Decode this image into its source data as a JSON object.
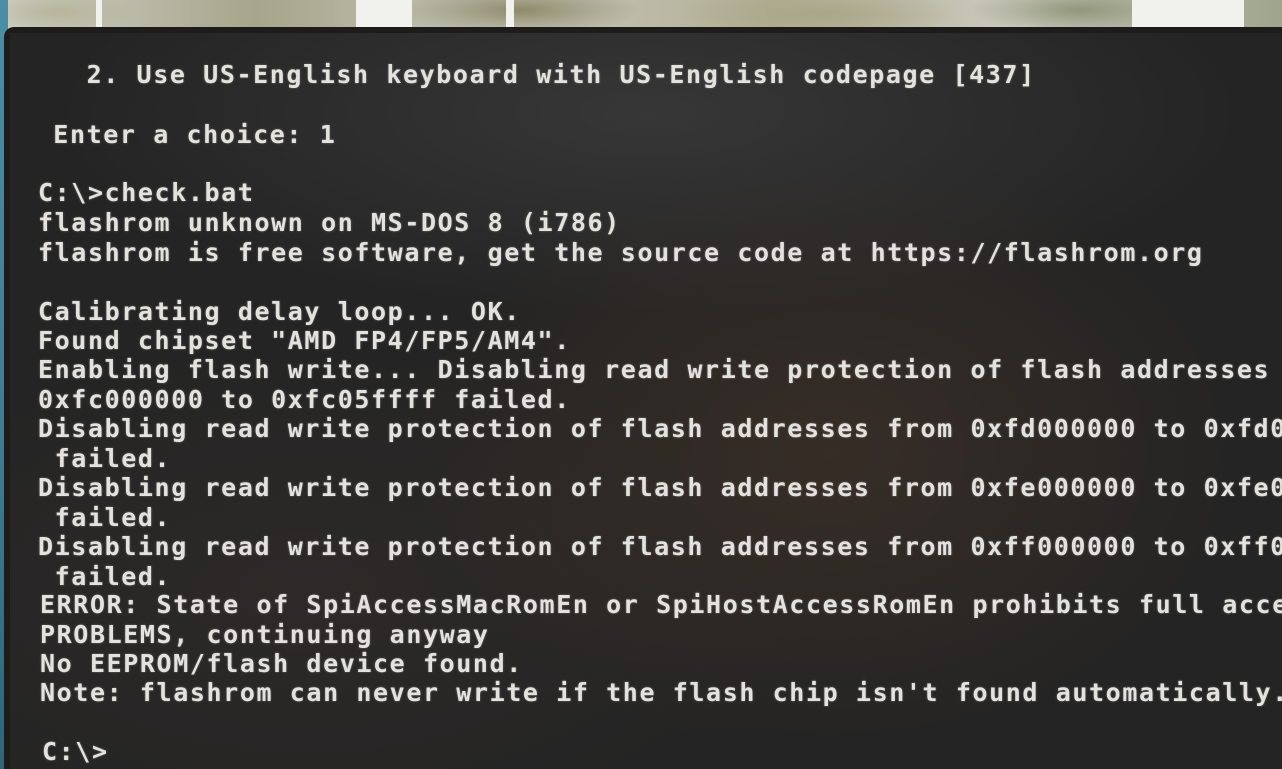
{
  "scene": {
    "description": "Photo of a monitor showing an MS-DOS console running flashrom check.bat"
  },
  "console": {
    "lines": [
      "    2. Use US-English keyboard with US-English codepage [437]",
      "  Enter a choice: 1",
      "C:\\>check.bat",
      "flashrom unknown on MS-DOS 8 (i786)",
      "flashrom is free software, get the source code at https://flashrom.org",
      "Calibrating delay loop... OK.",
      "Found chipset \"AMD FP4/FP5/AM4\".",
      "Enabling flash write... Disabling read write protection of flash addresses",
      "0xfc000000 to 0xfc05ffff failed.",
      "Disabling read write protection of flash addresses from 0xfd000000 to 0xfd0",
      " failed.",
      "Disabling read write protection of flash addresses from 0xfe000000 to 0xfe0",
      " failed.",
      "Disabling read write protection of flash addresses from 0xff000000 to 0xff0",
      " failed.",
      "ERROR: State of SpiAccessMacRomEn or SpiHostAccessRomEn prohibits full acce",
      "PROBLEMS, continuing anyway",
      "No EEPROM/flash device found.",
      "Note: flashrom can never write if the flash chip isn't found automatically.",
      "C:\\>"
    ]
  }
}
